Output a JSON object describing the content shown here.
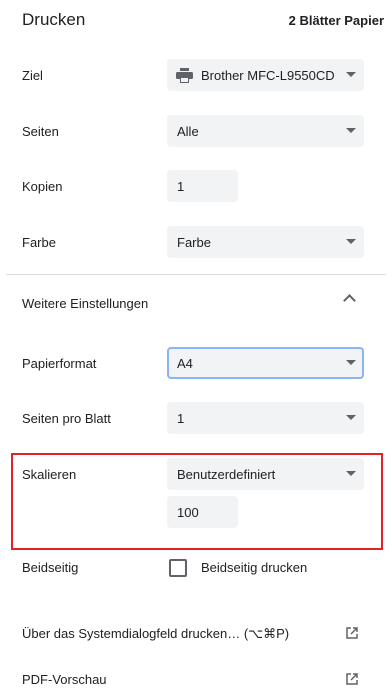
{
  "header": {
    "title": "Drucken",
    "sheets": "2 Blätter Papier"
  },
  "destination": {
    "label": "Ziel",
    "value": "Brother MFC-L9550CD"
  },
  "pages": {
    "label": "Seiten",
    "value": "Alle"
  },
  "copies": {
    "label": "Kopien",
    "value": "1"
  },
  "color": {
    "label": "Farbe",
    "value": "Farbe"
  },
  "more_settings": {
    "label": "Weitere Einstellungen"
  },
  "paper_size": {
    "label": "Papierformat",
    "value": "A4"
  },
  "pages_per_sheet": {
    "label": "Seiten pro Blatt",
    "value": "1"
  },
  "scale": {
    "label": "Skalieren",
    "value": "Benutzerdefiniert",
    "custom_value": "100"
  },
  "duplex": {
    "label": "Beidseitig",
    "checkbox_label": "Beidseitig drucken",
    "checked": false
  },
  "system_dialog": {
    "label": "Über das Systemdialogfeld drucken… (⌥⌘P)"
  },
  "pdf_preview": {
    "label": "PDF-Vorschau"
  },
  "colors": {
    "highlight": "#e32126",
    "field_bg": "#f1f3f4",
    "focus_border": "#8ab4f8"
  }
}
